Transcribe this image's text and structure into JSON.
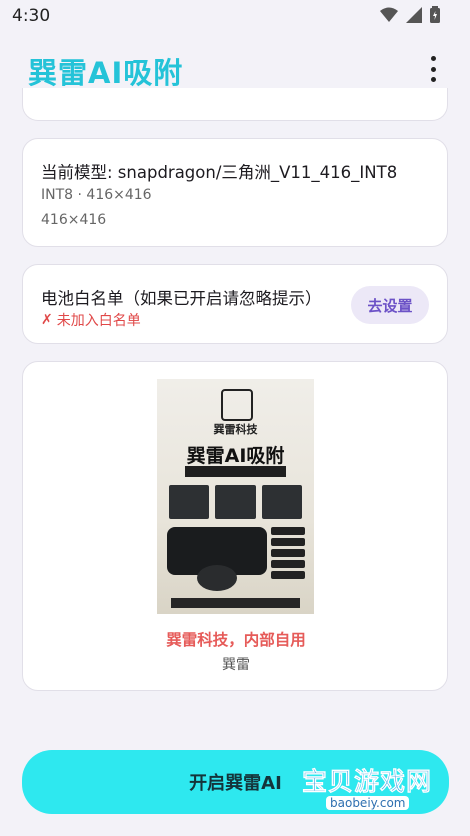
{
  "status_bar": {
    "time": "4:30",
    "icons": [
      "wifi-icon",
      "signal-icon",
      "battery-icon"
    ]
  },
  "app_bar": {
    "title": "巽雷AI吸附",
    "menu_icon": "more-vert-icon"
  },
  "model_card": {
    "title": "当前模型: snapdragon/三角洲_V11_416_INT8",
    "line1": "INT8 · 416×416",
    "line2": "416×416"
  },
  "battery_card": {
    "title": "电池白名单（如果已开启请忽略提示）",
    "status_icon": "✗",
    "status_text": "未加入白名单",
    "button_label": "去设置"
  },
  "banner_card": {
    "poster_brand": "巽雷科技",
    "poster_headline": "巽雷AI吸附",
    "title": "巽雷科技，内部自用",
    "subtitle": "巽雷"
  },
  "primary_button": {
    "label": "开启巽雷AI"
  },
  "watermark": {
    "text": "宝贝游戏网",
    "url": "baobeiy.com"
  },
  "colors": {
    "accent": "#25c3d8",
    "button": "#2ee8ef",
    "error": "#e04848",
    "chip_bg": "#ece8f7",
    "chip_text": "#6c52c7"
  }
}
